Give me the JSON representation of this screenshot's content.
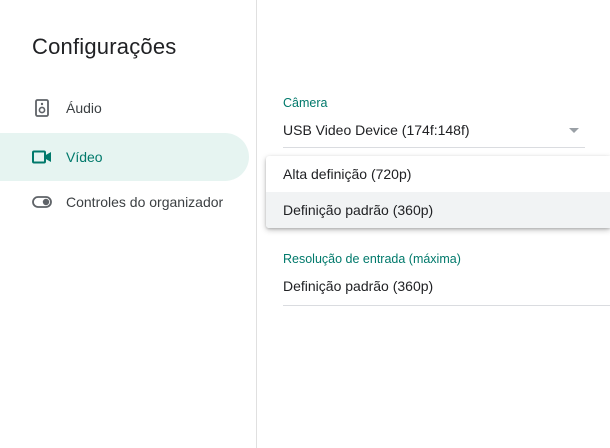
{
  "sidebar": {
    "title": "Configurações",
    "items": [
      {
        "label": "Áudio",
        "icon": "speaker-icon",
        "active": false
      },
      {
        "label": "Vídeo",
        "icon": "videocam-icon",
        "active": true
      },
      {
        "label": "Controles do organizador",
        "icon": "toggle-icon",
        "active": false
      }
    ]
  },
  "camera": {
    "label": "Câmera",
    "value": "USB Video Device (174f:148f)"
  },
  "dropdown": {
    "options": [
      "Alta definição (720p)",
      "Definição padrão (360p)"
    ],
    "selected_index": 1
  },
  "resolution": {
    "label": "Resolução de entrada (máxima)",
    "value": "Definição padrão (360p)"
  },
  "colors": {
    "accent": "#00796b",
    "active_bg": "#e6f4f1",
    "text": "#202124",
    "divider": "#dadce0"
  }
}
